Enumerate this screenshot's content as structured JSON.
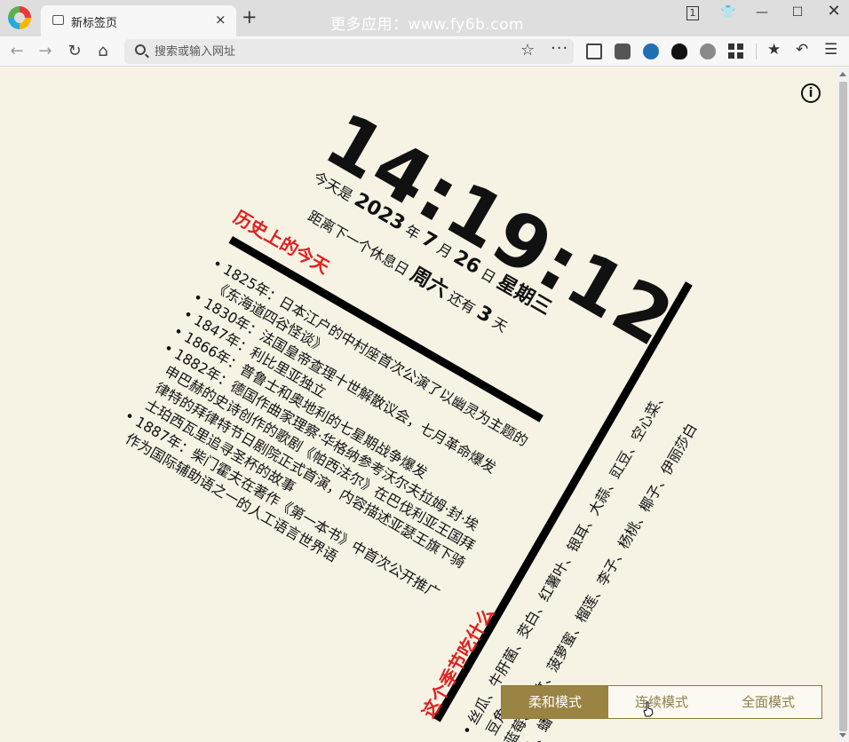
{
  "browser": {
    "tab_title": "新标签页",
    "tab_close": "×",
    "new_tab": "+",
    "promo_text": "更多应用：www.fy6b.com",
    "tab_count": "1",
    "address_placeholder": "搜索或输入网址"
  },
  "clock": {
    "time": "14:19:12",
    "date_prefix": "今天是",
    "year": "2023",
    "year_unit": "年",
    "month": "7",
    "month_unit": "月",
    "day": "26",
    "day_unit": "日",
    "weekday": "星期三",
    "rest_prefix": "距离下一个休息日",
    "rest_day": "周六",
    "rest_mid": "还有",
    "rest_count": "3",
    "rest_unit": "天"
  },
  "history": {
    "title": "历史上的今天",
    "items": [
      "1825年：日本江户的中村座首次公演了以幽灵为主题的《东海道四谷怪谈》",
      "1830年：法国皇帝查理十世解散议会，七月革命爆发",
      "1847年：利比里亚独立",
      "1866年：普鲁士和奥地利的七星期战争爆发",
      "1882年：德国作曲家理察·华格纳参考沃尔夫拉姆·封·埃申巴赫的史诗创作的歌剧《帕西法尔》在巴伐利亚王国拜律特的拜律特节日剧院正式首演，内容描述亚瑟王旗下骑士珀西瓦里追寻圣杯的故事",
      "1887年：柴门霍夫在著作《第一本书》中首次公开推广作为国际辅助语之一的人工语言世界语"
    ]
  },
  "season": {
    "title": "这个季节吃什么",
    "items": [
      "丝瓜、牛肝菌、茭白、红薯叶、银耳、大蒜、豇豆、空心菜、豆角",
      "蓝莓、山竹、菠萝蜜、榴莲、李子、杨桃、椰子、伊丽莎白瓜、蟠桃"
    ]
  },
  "modes": {
    "soft": "柔和模式",
    "continuous": "连续模式",
    "full": "全面模式"
  }
}
